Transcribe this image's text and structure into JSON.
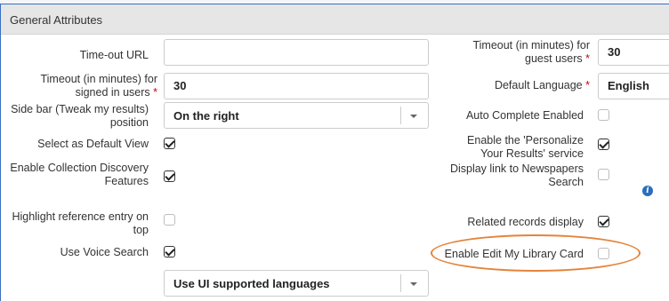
{
  "panel": {
    "title": "General Attributes"
  },
  "left": {
    "timeout_url": {
      "label": "Time-out URL",
      "value": ""
    },
    "timeout_signed": {
      "label_line1": "Timeout (in minutes) for",
      "label_line2": "signed in users",
      "required": "*",
      "value": "30"
    },
    "sidebar": {
      "label_line1": "Side bar (Tweak my results)",
      "label_line2": "position",
      "value": "On the right"
    },
    "default_view": {
      "label": "Select as Default View",
      "checked": true
    },
    "collection_discovery": {
      "label_line1": "Enable Collection Discovery",
      "label_line2": "Features",
      "checked": true
    },
    "highlight_reference": {
      "label_line1": "Highlight reference entry on",
      "label_line2": "top",
      "checked": false
    },
    "voice_search": {
      "label": "Use Voice Search",
      "checked": true
    },
    "languages_select": {
      "value": "Use UI supported languages"
    }
  },
  "right": {
    "timeout_guest": {
      "label_line1": "Timeout (in minutes) for",
      "label_line2": "guest users",
      "required": "*",
      "value": "30"
    },
    "default_language": {
      "label": "Default Language",
      "required": "*",
      "value": "English"
    },
    "auto_complete": {
      "label": "Auto Complete Enabled",
      "checked": false
    },
    "personalize": {
      "label_line1": "Enable the 'Personalize",
      "label_line2": "Your Results' service",
      "checked": true
    },
    "newspapers": {
      "label_line1": "Display link to Newspapers",
      "label_line2": "Search",
      "checked": false
    },
    "related_records": {
      "label": "Related records display",
      "checked": true
    },
    "edit_library_card": {
      "label": "Enable Edit My Library Card",
      "checked": false
    }
  },
  "annotation": {
    "color": "#e4843b"
  },
  "colors": {
    "required": "#d0021b",
    "info": "#2a6ebd",
    "header_bg": "#e6e6e6"
  }
}
